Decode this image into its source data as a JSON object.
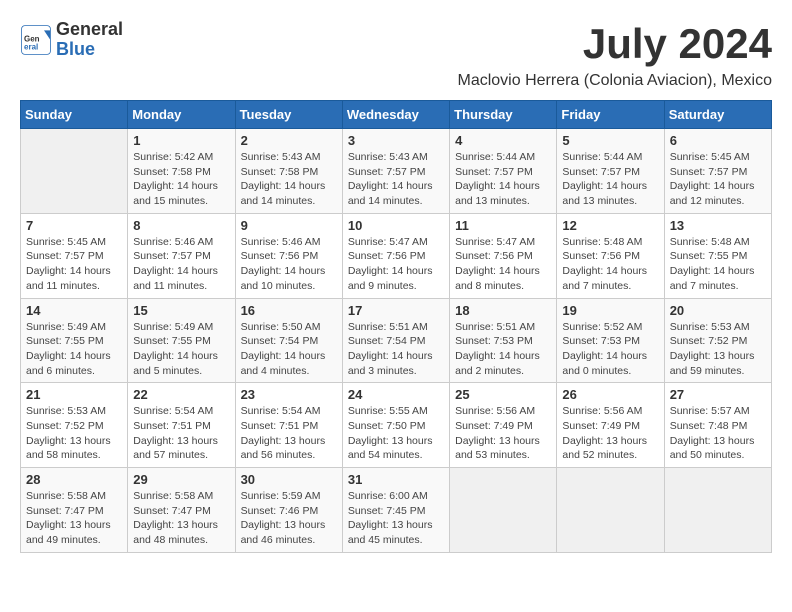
{
  "header": {
    "logo_general": "General",
    "logo_blue": "Blue",
    "month_title": "July 2024",
    "location": "Maclovio Herrera (Colonia Aviacion), Mexico"
  },
  "days_of_week": [
    "Sunday",
    "Monday",
    "Tuesday",
    "Wednesday",
    "Thursday",
    "Friday",
    "Saturday"
  ],
  "weeks": [
    [
      {
        "day": "",
        "info": ""
      },
      {
        "day": "1",
        "info": "Sunrise: 5:42 AM\nSunset: 7:58 PM\nDaylight: 14 hours\nand 15 minutes."
      },
      {
        "day": "2",
        "info": "Sunrise: 5:43 AM\nSunset: 7:58 PM\nDaylight: 14 hours\nand 14 minutes."
      },
      {
        "day": "3",
        "info": "Sunrise: 5:43 AM\nSunset: 7:57 PM\nDaylight: 14 hours\nand 14 minutes."
      },
      {
        "day": "4",
        "info": "Sunrise: 5:44 AM\nSunset: 7:57 PM\nDaylight: 14 hours\nand 13 minutes."
      },
      {
        "day": "5",
        "info": "Sunrise: 5:44 AM\nSunset: 7:57 PM\nDaylight: 14 hours\nand 13 minutes."
      },
      {
        "day": "6",
        "info": "Sunrise: 5:45 AM\nSunset: 7:57 PM\nDaylight: 14 hours\nand 12 minutes."
      }
    ],
    [
      {
        "day": "7",
        "info": "Sunrise: 5:45 AM\nSunset: 7:57 PM\nDaylight: 14 hours\nand 11 minutes."
      },
      {
        "day": "8",
        "info": "Sunrise: 5:46 AM\nSunset: 7:57 PM\nDaylight: 14 hours\nand 11 minutes."
      },
      {
        "day": "9",
        "info": "Sunrise: 5:46 AM\nSunset: 7:56 PM\nDaylight: 14 hours\nand 10 minutes."
      },
      {
        "day": "10",
        "info": "Sunrise: 5:47 AM\nSunset: 7:56 PM\nDaylight: 14 hours\nand 9 minutes."
      },
      {
        "day": "11",
        "info": "Sunrise: 5:47 AM\nSunset: 7:56 PM\nDaylight: 14 hours\nand 8 minutes."
      },
      {
        "day": "12",
        "info": "Sunrise: 5:48 AM\nSunset: 7:56 PM\nDaylight: 14 hours\nand 7 minutes."
      },
      {
        "day": "13",
        "info": "Sunrise: 5:48 AM\nSunset: 7:55 PM\nDaylight: 14 hours\nand 7 minutes."
      }
    ],
    [
      {
        "day": "14",
        "info": "Sunrise: 5:49 AM\nSunset: 7:55 PM\nDaylight: 14 hours\nand 6 minutes."
      },
      {
        "day": "15",
        "info": "Sunrise: 5:49 AM\nSunset: 7:55 PM\nDaylight: 14 hours\nand 5 minutes."
      },
      {
        "day": "16",
        "info": "Sunrise: 5:50 AM\nSunset: 7:54 PM\nDaylight: 14 hours\nand 4 minutes."
      },
      {
        "day": "17",
        "info": "Sunrise: 5:51 AM\nSunset: 7:54 PM\nDaylight: 14 hours\nand 3 minutes."
      },
      {
        "day": "18",
        "info": "Sunrise: 5:51 AM\nSunset: 7:53 PM\nDaylight: 14 hours\nand 2 minutes."
      },
      {
        "day": "19",
        "info": "Sunrise: 5:52 AM\nSunset: 7:53 PM\nDaylight: 14 hours\nand 0 minutes."
      },
      {
        "day": "20",
        "info": "Sunrise: 5:53 AM\nSunset: 7:52 PM\nDaylight: 13 hours\nand 59 minutes."
      }
    ],
    [
      {
        "day": "21",
        "info": "Sunrise: 5:53 AM\nSunset: 7:52 PM\nDaylight: 13 hours\nand 58 minutes."
      },
      {
        "day": "22",
        "info": "Sunrise: 5:54 AM\nSunset: 7:51 PM\nDaylight: 13 hours\nand 57 minutes."
      },
      {
        "day": "23",
        "info": "Sunrise: 5:54 AM\nSunset: 7:51 PM\nDaylight: 13 hours\nand 56 minutes."
      },
      {
        "day": "24",
        "info": "Sunrise: 5:55 AM\nSunset: 7:50 PM\nDaylight: 13 hours\nand 54 minutes."
      },
      {
        "day": "25",
        "info": "Sunrise: 5:56 AM\nSunset: 7:49 PM\nDaylight: 13 hours\nand 53 minutes."
      },
      {
        "day": "26",
        "info": "Sunrise: 5:56 AM\nSunset: 7:49 PM\nDaylight: 13 hours\nand 52 minutes."
      },
      {
        "day": "27",
        "info": "Sunrise: 5:57 AM\nSunset: 7:48 PM\nDaylight: 13 hours\nand 50 minutes."
      }
    ],
    [
      {
        "day": "28",
        "info": "Sunrise: 5:58 AM\nSunset: 7:47 PM\nDaylight: 13 hours\nand 49 minutes."
      },
      {
        "day": "29",
        "info": "Sunrise: 5:58 AM\nSunset: 7:47 PM\nDaylight: 13 hours\nand 48 minutes."
      },
      {
        "day": "30",
        "info": "Sunrise: 5:59 AM\nSunset: 7:46 PM\nDaylight: 13 hours\nand 46 minutes."
      },
      {
        "day": "31",
        "info": "Sunrise: 6:00 AM\nSunset: 7:45 PM\nDaylight: 13 hours\nand 45 minutes."
      },
      {
        "day": "",
        "info": ""
      },
      {
        "day": "",
        "info": ""
      },
      {
        "day": "",
        "info": ""
      }
    ]
  ]
}
